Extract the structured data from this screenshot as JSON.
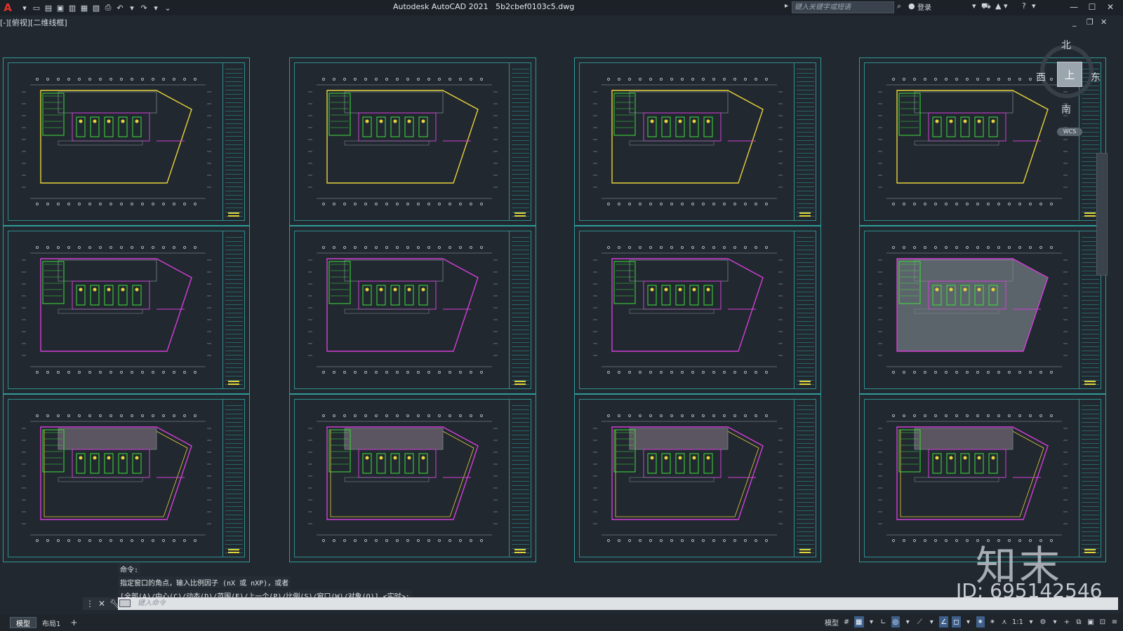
{
  "window": {
    "app_title": "Autodesk AutoCAD 2021",
    "file_name": "5b2cbef0103c5.dwg",
    "search_placeholder": "键入关键字或短语",
    "login_label": "登录"
  },
  "viewport": {
    "label": "[-][俯视][二维线框]"
  },
  "viewcube": {
    "north": "北",
    "south": "南",
    "east": "东",
    "west": "西",
    "face": "上",
    "wcs": "WCS"
  },
  "command": {
    "history": [
      "命令:",
      "指定窗口的角点，输入比例因子 (nX 或 nXP)，或者",
      "[全部(A)/中心(C)/动态(D)/范围(E)/上一个(P)/比例(S)/窗口(W)/对象(O)] <实时>:"
    ],
    "placeholder": "键入命令"
  },
  "layout_tabs": {
    "model": "模型",
    "layout1": "布局1",
    "add": "+"
  },
  "statusbar": {
    "model_label": "模型",
    "scale": "1:1"
  },
  "watermark": {
    "logo": "知末",
    "id": "ID: 695142546"
  },
  "colors": {
    "background": "#212830",
    "frame": "#2f9a9a",
    "magenta": "#d23fd6",
    "yellow": "#e8d23a",
    "green": "#3ee03a",
    "gray": "#7b858d"
  }
}
